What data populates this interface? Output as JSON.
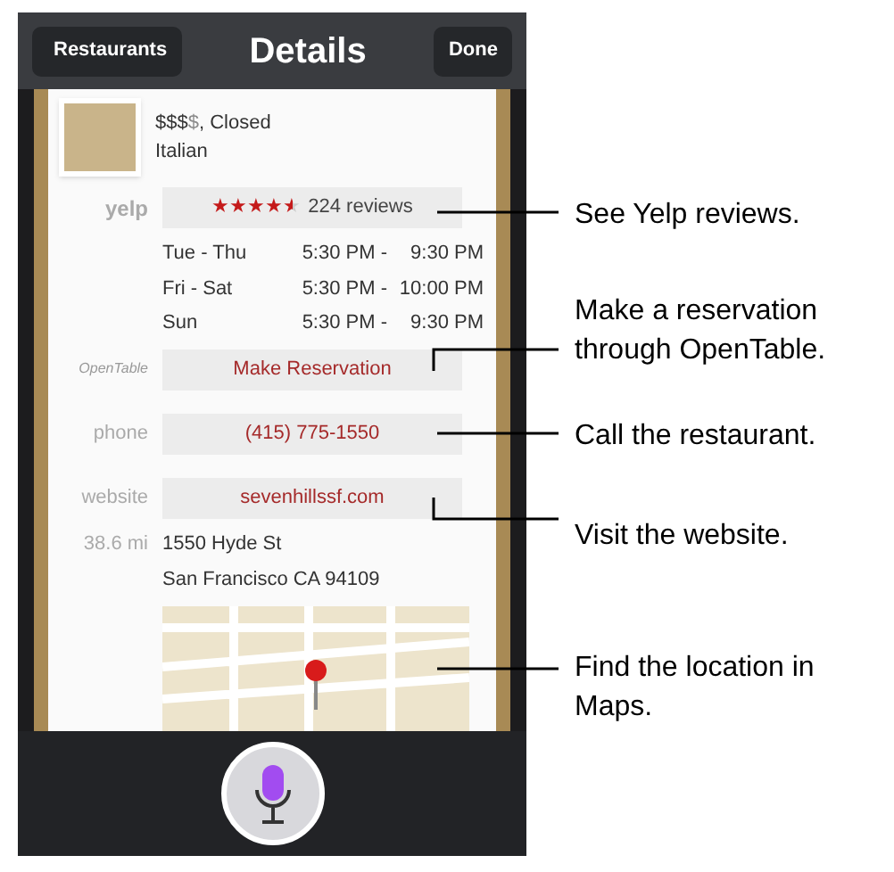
{
  "nav_bar": {
    "back_button": "Restaurants",
    "title": "Details",
    "done_button": "Done"
  },
  "restaurant": {
    "price_filled": "$$$",
    "price_empty": "$",
    "status": ", Closed",
    "cuisine": "Italian"
  },
  "yelp": {
    "label": "yelp",
    "stars": 4.5,
    "reviews": "224 reviews"
  },
  "hours": [
    {
      "days": "Tue - Thu",
      "open": "5:30 PM -",
      "close": "9:30 PM"
    },
    {
      "days": "Fri - Sat",
      "open": "5:30 PM -",
      "close": "10:00 PM"
    },
    {
      "days": "Sun",
      "open": "5:30 PM -",
      "close": "9:30 PM"
    }
  ],
  "actions": [
    {
      "label": "OpenTable",
      "kind": "logo",
      "value": "Make Reservation"
    },
    {
      "label": "phone",
      "kind": "text",
      "value": "(415) 775-1550"
    },
    {
      "label": "website",
      "kind": "text",
      "value": "sevenhillssf.com"
    }
  ],
  "address": {
    "distance": "38.6 mi",
    "lines": [
      "1550 Hyde St",
      "San Francisco CA 94109"
    ]
  },
  "callouts": [
    {
      "lines": [
        "See Yelp reviews."
      ]
    },
    {
      "lines": [
        "Make a reservation",
        "through OpenTable."
      ]
    },
    {
      "lines": [
        "Call the restaurant."
      ]
    },
    {
      "lines": [
        "Visit the website."
      ]
    },
    {
      "lines": [
        "Find the location in",
        "Maps."
      ]
    }
  ]
}
